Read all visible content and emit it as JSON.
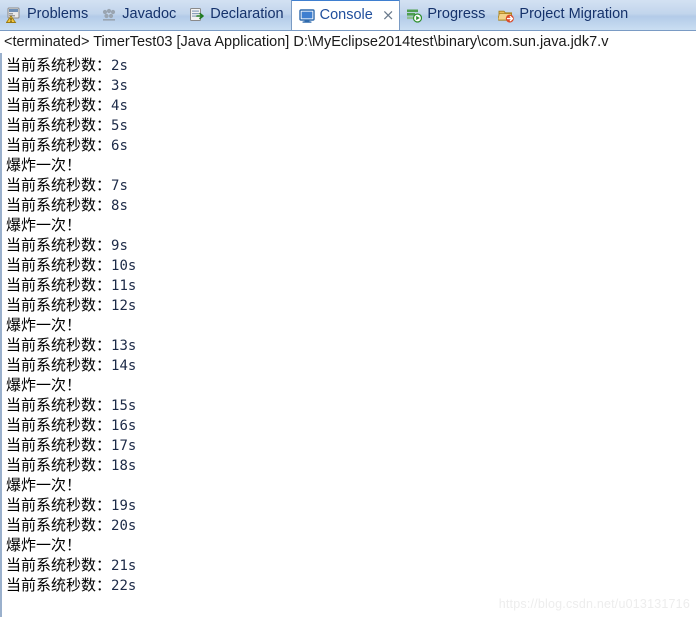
{
  "tabs": [
    {
      "label": "Problems",
      "icon": "problems-icon",
      "active": false,
      "closable": false
    },
    {
      "label": "Javadoc",
      "icon": "javadoc-icon",
      "active": false,
      "closable": false
    },
    {
      "label": "Declaration",
      "icon": "declaration-icon",
      "active": false,
      "closable": false
    },
    {
      "label": "Console",
      "icon": "console-icon",
      "active": true,
      "closable": true
    },
    {
      "label": "Progress",
      "icon": "progress-icon",
      "active": false,
      "closable": false
    },
    {
      "label": "Project Migration",
      "icon": "project-migration-icon",
      "active": false,
      "closable": false
    }
  ],
  "tab_close_glyph": "×",
  "launch": {
    "status": "<terminated>",
    "config_name": "TimerTest03",
    "launch_type": "[Java Application]",
    "path": "D:\\MyEclipse2014test\\binary\\com.sun.java.jdk7.v",
    "full_line": "<terminated> TimerTest03 [Java Application] D:\\MyEclipse2014test\\binary\\com.sun.java.jdk7.v"
  },
  "console": {
    "lines": [
      "当前系统秒数：2s",
      "当前系统秒数：3s",
      "当前系统秒数：4s",
      "当前系统秒数：5s",
      "当前系统秒数：6s",
      "爆炸一次！",
      "当前系统秒数：7s",
      "当前系统秒数：8s",
      "爆炸一次！",
      "当前系统秒数：9s",
      "当前系统秒数：10s",
      "当前系统秒数：11s",
      "当前系统秒数：12s",
      "爆炸一次！",
      "当前系统秒数：13s",
      "当前系统秒数：14s",
      "爆炸一次！",
      "当前系统秒数：15s",
      "当前系统秒数：16s",
      "当前系统秒数：17s",
      "当前系统秒数：18s",
      "爆炸一次！",
      "当前系统秒数：19s",
      "当前系统秒数：20s",
      "爆炸一次！",
      "当前系统秒数：21s",
      "当前系统秒数：22s"
    ]
  },
  "watermark": {
    "text": "https://blog.csdn.net/u013131716"
  },
  "colors": {
    "tabbar_blue": "#c2d5ec",
    "tab_text": "#15326b",
    "active_tab_text": "#1f4e9c",
    "active_tab_bg": "#ffffff",
    "active_tab_top_accent": "#3f7fd0",
    "console_text": "#000000",
    "console_bg": "#ffffff",
    "border": "#7a9bc4",
    "watermark": "#ededed"
  }
}
